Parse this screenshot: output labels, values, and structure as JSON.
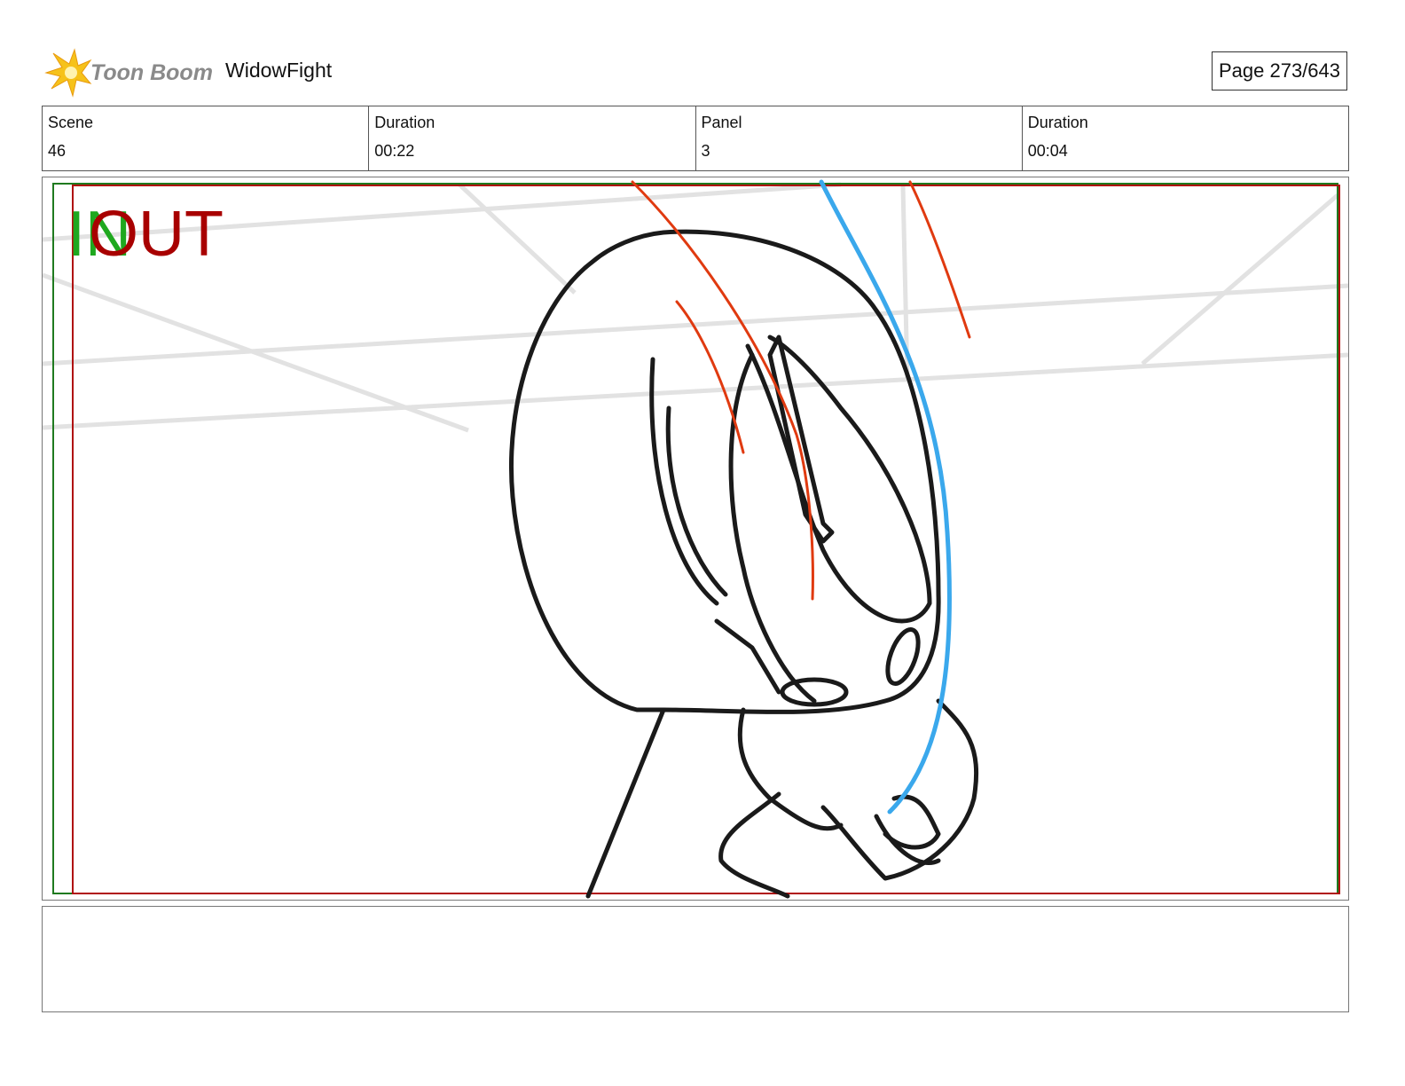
{
  "header": {
    "logo_text": "Toon Boom",
    "project_title": "WidowFight",
    "page_label": "Page 273/643"
  },
  "info": {
    "scene_label": "Scene",
    "scene_value": "46",
    "scene_duration_label": "Duration",
    "scene_duration_value": "00:22",
    "panel_label": "Panel",
    "panel_value": "3",
    "panel_duration_label": "Duration",
    "panel_duration_value": "00:04"
  },
  "panel": {
    "in_marker": "IN",
    "out_marker": "OUT"
  },
  "notes": {
    "text": ""
  },
  "colors": {
    "in_marker": "#1fa81f",
    "out_marker": "#a80000",
    "sketch_line": "#1a1a1a",
    "red_motion": "#e03a10",
    "blue_motion": "#3aa8ec",
    "background_lines": "#e2e2e2"
  }
}
